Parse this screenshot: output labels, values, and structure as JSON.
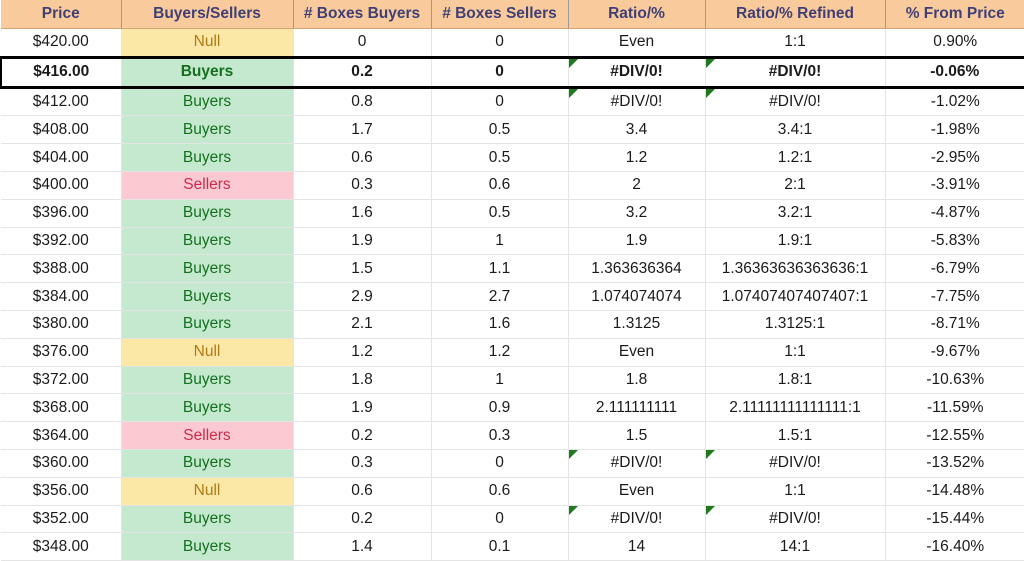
{
  "sheet": {
    "title": "Price Level Buyers/Sellers Box Ratio Table",
    "colors": {
      "header_bg": "#F9CB9C",
      "header_text": "#3F3F76",
      "buyers_bg": "#C5E9CF",
      "buyers_text": "#14701F",
      "sellers_bg": "#FAC9D2",
      "sellers_text": "#CF2A4B",
      "null_bg": "#FCE8A6",
      "null_text": "#B07A14",
      "error_triangle": "#1F7A1F",
      "selection_border": "#000000"
    },
    "columns": [
      {
        "key": "price",
        "label": "Price"
      },
      {
        "key": "signal",
        "label": "Buyers/Sellers"
      },
      {
        "key": "boxes_buy",
        "label": "# Boxes Buyers"
      },
      {
        "key": "boxes_sell",
        "label": "# Boxes Sellers"
      },
      {
        "key": "ratio",
        "label": "Ratio/%"
      },
      {
        "key": "ratio_ref",
        "label": "Ratio/% Refined"
      },
      {
        "key": "pct",
        "label": "% From Price"
      }
    ],
    "rows": [
      {
        "price": "$420.00",
        "signal": "Null",
        "signal_type": "null",
        "boxes_buy": "0",
        "boxes_sell": "0",
        "ratio": "Even",
        "ratio_error": false,
        "ratio_ref": "1:1",
        "ratio_ref_error": false,
        "pct": "0.90%",
        "highlighted": false
      },
      {
        "price": "$416.00",
        "signal": "Buyers",
        "signal_type": "buyers",
        "boxes_buy": "0.2",
        "boxes_sell": "0",
        "ratio": "#DIV/0!",
        "ratio_error": true,
        "ratio_ref": "#DIV/0!",
        "ratio_ref_error": true,
        "pct": "-0.06%",
        "highlighted": true
      },
      {
        "price": "$412.00",
        "signal": "Buyers",
        "signal_type": "buyers",
        "boxes_buy": "0.8",
        "boxes_sell": "0",
        "ratio": "#DIV/0!",
        "ratio_error": true,
        "ratio_ref": "#DIV/0!",
        "ratio_ref_error": true,
        "pct": "-1.02%",
        "highlighted": false
      },
      {
        "price": "$408.00",
        "signal": "Buyers",
        "signal_type": "buyers",
        "boxes_buy": "1.7",
        "boxes_sell": "0.5",
        "ratio": "3.4",
        "ratio_error": false,
        "ratio_ref": "3.4:1",
        "ratio_ref_error": false,
        "pct": "-1.98%",
        "highlighted": false
      },
      {
        "price": "$404.00",
        "signal": "Buyers",
        "signal_type": "buyers",
        "boxes_buy": "0.6",
        "boxes_sell": "0.5",
        "ratio": "1.2",
        "ratio_error": false,
        "ratio_ref": "1.2:1",
        "ratio_ref_error": false,
        "pct": "-2.95%",
        "highlighted": false
      },
      {
        "price": "$400.00",
        "signal": "Sellers",
        "signal_type": "sellers",
        "boxes_buy": "0.3",
        "boxes_sell": "0.6",
        "ratio": "2",
        "ratio_error": false,
        "ratio_ref": "2:1",
        "ratio_ref_error": false,
        "pct": "-3.91%",
        "highlighted": false
      },
      {
        "price": "$396.00",
        "signal": "Buyers",
        "signal_type": "buyers",
        "boxes_buy": "1.6",
        "boxes_sell": "0.5",
        "ratio": "3.2",
        "ratio_error": false,
        "ratio_ref": "3.2:1",
        "ratio_ref_error": false,
        "pct": "-4.87%",
        "highlighted": false
      },
      {
        "price": "$392.00",
        "signal": "Buyers",
        "signal_type": "buyers",
        "boxes_buy": "1.9",
        "boxes_sell": "1",
        "ratio": "1.9",
        "ratio_error": false,
        "ratio_ref": "1.9:1",
        "ratio_ref_error": false,
        "pct": "-5.83%",
        "highlighted": false
      },
      {
        "price": "$388.00",
        "signal": "Buyers",
        "signal_type": "buyers",
        "boxes_buy": "1.5",
        "boxes_sell": "1.1",
        "ratio": "1.363636364",
        "ratio_error": false,
        "ratio_ref": "1.36363636363636:1",
        "ratio_ref_error": false,
        "pct": "-6.79%",
        "highlighted": false
      },
      {
        "price": "$384.00",
        "signal": "Buyers",
        "signal_type": "buyers",
        "boxes_buy": "2.9",
        "boxes_sell": "2.7",
        "ratio": "1.074074074",
        "ratio_error": false,
        "ratio_ref": "1.07407407407407:1",
        "ratio_ref_error": false,
        "pct": "-7.75%",
        "highlighted": false
      },
      {
        "price": "$380.00",
        "signal": "Buyers",
        "signal_type": "buyers",
        "boxes_buy": "2.1",
        "boxes_sell": "1.6",
        "ratio": "1.3125",
        "ratio_error": false,
        "ratio_ref": "1.3125:1",
        "ratio_ref_error": false,
        "pct": "-8.71%",
        "highlighted": false
      },
      {
        "price": "$376.00",
        "signal": "Null",
        "signal_type": "null",
        "boxes_buy": "1.2",
        "boxes_sell": "1.2",
        "ratio": "Even",
        "ratio_error": false,
        "ratio_ref": "1:1",
        "ratio_ref_error": false,
        "pct": "-9.67%",
        "highlighted": false
      },
      {
        "price": "$372.00",
        "signal": "Buyers",
        "signal_type": "buyers",
        "boxes_buy": "1.8",
        "boxes_sell": "1",
        "ratio": "1.8",
        "ratio_error": false,
        "ratio_ref": "1.8:1",
        "ratio_ref_error": false,
        "pct": "-10.63%",
        "highlighted": false
      },
      {
        "price": "$368.00",
        "signal": "Buyers",
        "signal_type": "buyers",
        "boxes_buy": "1.9",
        "boxes_sell": "0.9",
        "ratio": "2.111111111",
        "ratio_error": false,
        "ratio_ref": "2.11111111111111:1",
        "ratio_ref_error": false,
        "pct": "-11.59%",
        "highlighted": false
      },
      {
        "price": "$364.00",
        "signal": "Sellers",
        "signal_type": "sellers",
        "boxes_buy": "0.2",
        "boxes_sell": "0.3",
        "ratio": "1.5",
        "ratio_error": false,
        "ratio_ref": "1.5:1",
        "ratio_ref_error": false,
        "pct": "-12.55%",
        "highlighted": false
      },
      {
        "price": "$360.00",
        "signal": "Buyers",
        "signal_type": "buyers",
        "boxes_buy": "0.3",
        "boxes_sell": "0",
        "ratio": "#DIV/0!",
        "ratio_error": true,
        "ratio_ref": "#DIV/0!",
        "ratio_ref_error": true,
        "pct": "-13.52%",
        "highlighted": false
      },
      {
        "price": "$356.00",
        "signal": "Null",
        "signal_type": "null",
        "boxes_buy": "0.6",
        "boxes_sell": "0.6",
        "ratio": "Even",
        "ratio_error": false,
        "ratio_ref": "1:1",
        "ratio_ref_error": false,
        "pct": "-14.48%",
        "highlighted": false
      },
      {
        "price": "$352.00",
        "signal": "Buyers",
        "signal_type": "buyers",
        "boxes_buy": "0.2",
        "boxes_sell": "0",
        "ratio": "#DIV/0!",
        "ratio_error": true,
        "ratio_ref": "#DIV/0!",
        "ratio_ref_error": true,
        "pct": "-15.44%",
        "highlighted": false
      },
      {
        "price": "$348.00",
        "signal": "Buyers",
        "signal_type": "buyers",
        "boxes_buy": "1.4",
        "boxes_sell": "0.1",
        "ratio": "14",
        "ratio_error": false,
        "ratio_ref": "14:1",
        "ratio_ref_error": false,
        "pct": "-16.40%",
        "highlighted": false
      }
    ]
  }
}
